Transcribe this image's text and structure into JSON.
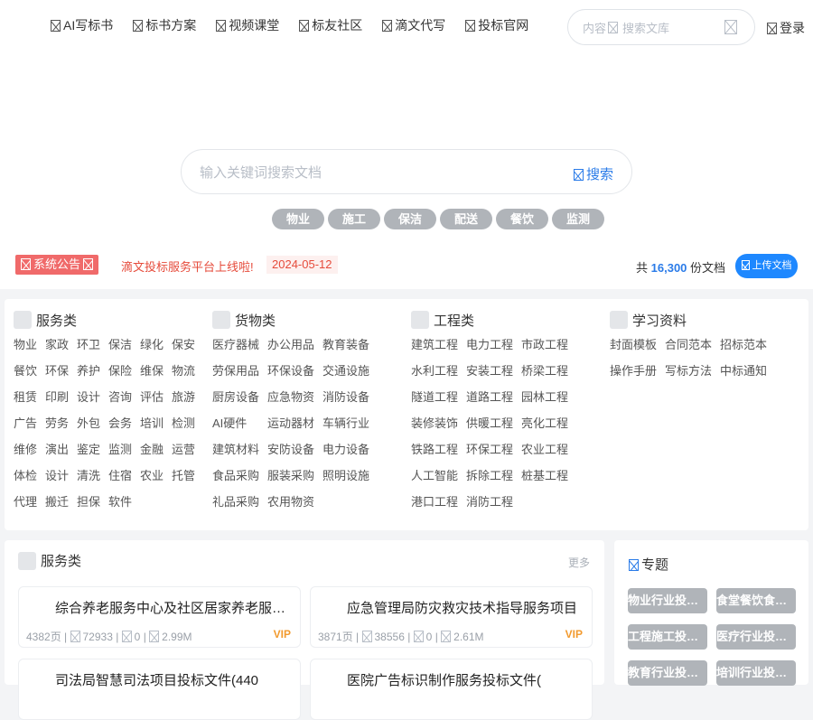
{
  "nav": {
    "items": [
      "AI写标书",
      "标书方案",
      "视频课堂",
      "标友社区",
      "滴文代写",
      "投标官网"
    ],
    "search_scope": "内容",
    "search_placeholder": "搜索文库",
    "login": "登录"
  },
  "hero": {
    "search_placeholder": "输入关键词搜索文档",
    "search_button": "搜索",
    "hot_tags": [
      "物业",
      "施工",
      "保洁",
      "配送",
      "餐饮",
      "监测"
    ]
  },
  "notice": {
    "label": "系统公告",
    "text": "滴文投标服务平台上线啦!",
    "date": "2024-05-12",
    "count_prefix": "共",
    "count": "16,300",
    "count_suffix": "份文档",
    "upload_button": "上传文档"
  },
  "categories": [
    {
      "title": "服务类",
      "items": [
        "物业",
        "家政",
        "环卫",
        "保洁",
        "绿化",
        "保安",
        "餐饮",
        "环保",
        "养护",
        "保险",
        "维保",
        "物流",
        "租赁",
        "印刷",
        "设计",
        "咨询",
        "评估",
        "旅游",
        "广告",
        "劳务",
        "外包",
        "会务",
        "培训",
        "检测",
        "维修",
        "演出",
        "鉴定",
        "监测",
        "金融",
        "运营",
        "体检",
        "设计",
        "清洗",
        "住宿",
        "农业",
        "托管",
        "代理",
        "搬迁",
        "担保",
        "软件"
      ]
    },
    {
      "title": "货物类",
      "items": [
        "医疗器械",
        "办公用品",
        "教育装备",
        "劳保用品",
        "环保设备",
        "交通设施",
        "厨房设备",
        "应急物资",
        "消防设备",
        "AI硬件",
        "运动器材",
        "车辆行业",
        "建筑材料",
        "安防设备",
        "电力设备",
        "食品采购",
        "服装采购",
        "照明设施",
        "礼品采购",
        "农用物资"
      ]
    },
    {
      "title": "工程类",
      "items": [
        "建筑工程",
        "电力工程",
        "市政工程",
        "水利工程",
        "安装工程",
        "桥梁工程",
        "隧道工程",
        "道路工程",
        "园林工程",
        "装修装饰",
        "供暖工程",
        "亮化工程",
        "铁路工程",
        "环保工程",
        "农业工程",
        "人工智能",
        "拆除工程",
        "桩基工程",
        "港口工程",
        "消防工程"
      ]
    },
    {
      "title": "学习资料",
      "items": [
        "封面模板",
        "合同范本",
        "招标范本",
        "操作手册",
        "写标方法",
        "中标通知"
      ]
    }
  ],
  "section": {
    "title": "服务类",
    "more": "更多",
    "docs": [
      {
        "title": "综合养老服务中心及社区居家养老服务项目",
        "pages": "4382页",
        "views": "72933",
        "downloads": "0",
        "size": "2.99M",
        "badge": "VIP"
      },
      {
        "title": "应急管理局防灾救灾技术指导服务项目",
        "pages": "3871页",
        "views": "38556",
        "downloads": "0",
        "size": "2.61M",
        "badge": "VIP"
      },
      {
        "title": "司法局智慧司法项目投标文件(440",
        "pages": "",
        "views": "",
        "downloads": "",
        "size": "",
        "badge": ""
      },
      {
        "title": "医院广告标识制作服务投标文件(",
        "pages": "",
        "views": "",
        "downloads": "",
        "size": "",
        "badge": ""
      }
    ]
  },
  "topics": {
    "title": "专题",
    "items": [
      "物业行业投标文件",
      "食堂餐饮食材配送",
      "工程施工投标文件",
      "医疗行业投标文件",
      "教育行业投标文件",
      "培训行业投标文件"
    ]
  }
}
